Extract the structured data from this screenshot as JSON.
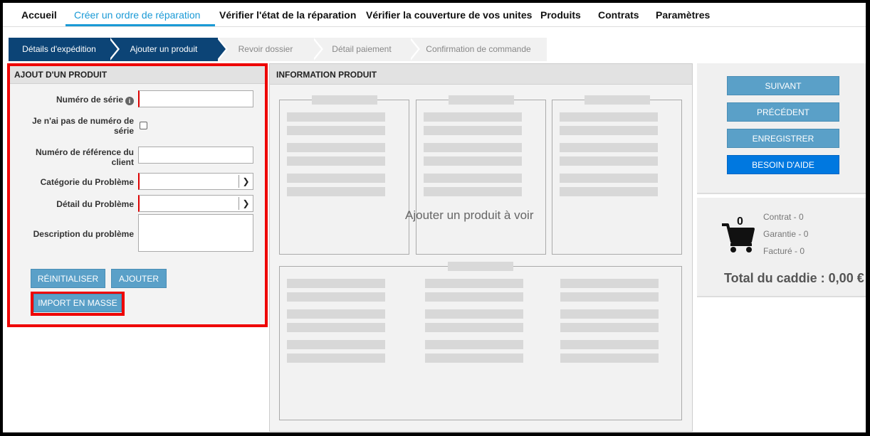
{
  "nav": {
    "items": [
      "Accueil",
      "Créer un ordre de réparation",
      "Vérifier l'état de la réparation",
      "Vérifier la couverture de vos unites",
      "Produits",
      "Contrats",
      "Paramètres"
    ]
  },
  "steps": [
    "Détails d'expédition",
    "Ajouter un produit",
    "Revoir dossier",
    "Détail paiement",
    "Confirmation de commande"
  ],
  "add_product": {
    "title": "AJOUT D'UN PRODUIT",
    "serial_label": "Numéro de série",
    "serial_value": "",
    "no_serial_label": "Je n'ai pas de numéro de série",
    "no_serial_checked": false,
    "client_ref_label": "Numéro de référence du client",
    "client_ref_value": "",
    "problem_category_label": "Catégorie du Problème",
    "problem_category_value": "",
    "problem_detail_label": "Détail du Problème",
    "problem_detail_value": "",
    "description_label": "Description du problème",
    "description_value": "",
    "reset_button": "RÉINITIALISER",
    "add_button": "AJOUTER",
    "bulk_import_button": "IMPORT EN MASSE"
  },
  "product_info": {
    "title": "INFORMATION PRODUIT",
    "placeholder": "Ajouter un produit à voir"
  },
  "actions": {
    "next": "SUIVANT",
    "previous": "PRÉCÉDENT",
    "save": "ENREGISTRER",
    "help": "BESOIN D'AIDE"
  },
  "cart": {
    "count": "0",
    "contract": "Contrat - 0",
    "warranty": "Garantie - 0",
    "billed": "Facturé - 0",
    "total": "Total du caddie : 0,00 €"
  },
  "colors": {
    "accent": "#1a9ad6",
    "step_active": "#0c4476",
    "button": "#5aa0c8",
    "help_button": "#0078e0",
    "highlight": "#ee0000"
  }
}
